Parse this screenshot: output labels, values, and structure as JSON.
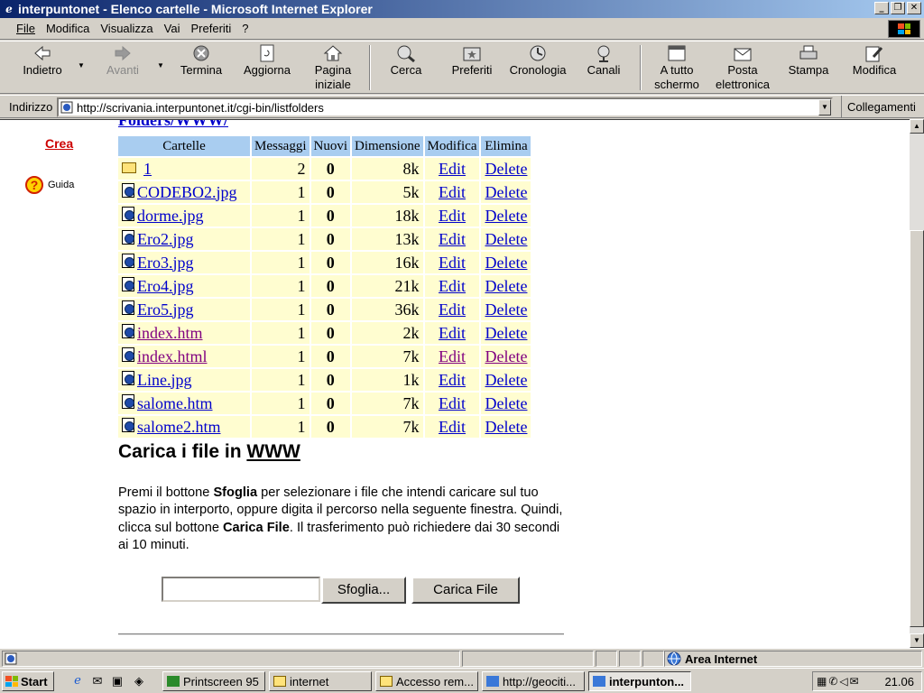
{
  "window": {
    "title": "interpuntonet - Elenco cartelle - Microsoft Internet Explorer"
  },
  "menu": [
    "File",
    "Modifica",
    "Visualizza",
    "Vai",
    "Preferiti",
    "?"
  ],
  "toolbar": {
    "back": "Indietro",
    "forward": "Avanti",
    "stop": "Termina",
    "refresh": "Aggiorna",
    "home_l1": "Pagina",
    "home_l2": "iniziale",
    "search": "Cerca",
    "favorites": "Preferiti",
    "history": "Cronologia",
    "channels": "Canali",
    "fullscreen_l1": "A tutto",
    "fullscreen_l2": "schermo",
    "mail_l1": "Posta",
    "mail_l2": "elettronica",
    "print": "Stampa",
    "edit": "Modifica"
  },
  "address": {
    "label": "Indirizzo",
    "url": "http://scrivania.interpuntonet.it/cgi-bin/listfolders",
    "links": "Collegamenti"
  },
  "sidebar": {
    "crea": "Crea",
    "guida": "Guida"
  },
  "page": {
    "header_cut": "Folders/WWW/",
    "columns": [
      "Cartelle",
      "Messaggi",
      "Nuovi",
      "Dimensione",
      "Modifica",
      "Elimina"
    ],
    "rows": [
      {
        "name": "1",
        "messages": "2",
        "new": "0",
        "size": "8k",
        "edit": "Edit",
        "del": "Delete",
        "icon": "folder-icon",
        "visited": false
      },
      {
        "name": "CODEBO2.jpg",
        "messages": "1",
        "new": "0",
        "size": "5k",
        "edit": "Edit",
        "del": "Delete",
        "icon": "file-icon",
        "visited": false
      },
      {
        "name": "dorme.jpg",
        "messages": "1",
        "new": "0",
        "size": "18k",
        "edit": "Edit",
        "del": "Delete",
        "icon": "file-icon",
        "visited": false
      },
      {
        "name": "Ero2.jpg",
        "messages": "1",
        "new": "0",
        "size": "13k",
        "edit": "Edit",
        "del": "Delete",
        "icon": "file-icon",
        "visited": false
      },
      {
        "name": "Ero3.jpg",
        "messages": "1",
        "new": "0",
        "size": "16k",
        "edit": "Edit",
        "del": "Delete",
        "icon": "file-icon",
        "visited": false
      },
      {
        "name": "Ero4.jpg",
        "messages": "1",
        "new": "0",
        "size": "21k",
        "edit": "Edit",
        "del": "Delete",
        "icon": "file-icon",
        "visited": false
      },
      {
        "name": "Ero5.jpg",
        "messages": "1",
        "new": "0",
        "size": "36k",
        "edit": "Edit",
        "del": "Delete",
        "icon": "file-icon",
        "visited": false
      },
      {
        "name": "index.htm",
        "messages": "1",
        "new": "0",
        "size": "2k",
        "edit": "Edit",
        "del": "Delete",
        "icon": "file-icon",
        "visited": true
      },
      {
        "name": "index.html",
        "messages": "1",
        "new": "0",
        "size": "7k",
        "edit": "Edit",
        "del": "Delete",
        "icon": "file-icon",
        "visited": true,
        "row_visited": true
      },
      {
        "name": "Line.jpg",
        "messages": "1",
        "new": "0",
        "size": "1k",
        "edit": "Edit",
        "del": "Delete",
        "icon": "file-icon",
        "visited": false
      },
      {
        "name": "salome.htm",
        "messages": "1",
        "new": "0",
        "size": "7k",
        "edit": "Edit",
        "del": "Delete",
        "icon": "file-icon",
        "visited": false
      },
      {
        "name": "salome2.htm",
        "messages": "1",
        "new": "0",
        "size": "7k",
        "edit": "Edit",
        "del": "Delete",
        "icon": "file-icon",
        "visited": false
      }
    ],
    "upload": {
      "heading_prefix": "Carica i file in ",
      "heading_link": "WWW",
      "p1": "Premi il bottone ",
      "b1": "Sfoglia",
      "p2": " per selezionare i file che intendi caricare sul tuo spazio in interporto, oppure digita il percorso nella seguente finestra. Quindi, clicca sul bottone ",
      "b2": "Carica File",
      "p3": ". Il trasferimento può richiedere dai 30 secondi ai 10 minuti.",
      "browse": "Sfoglia...",
      "submit": "Carica File"
    }
  },
  "status": {
    "zone": "Area Internet"
  },
  "taskbar": {
    "start": "Start",
    "tasks": [
      "Printscreen 95",
      "internet",
      "Accesso rem...",
      "http://geociti...",
      "interpunton..."
    ],
    "clock": "21.06"
  },
  "colors": {
    "title_start": "#0a246a",
    "title_end": "#a6caf0",
    "header_cell": "#a9cdf0",
    "row_cell": "#fffdd0",
    "link": "#0000cc",
    "visited": "#800080",
    "crea": "#cc0000"
  }
}
